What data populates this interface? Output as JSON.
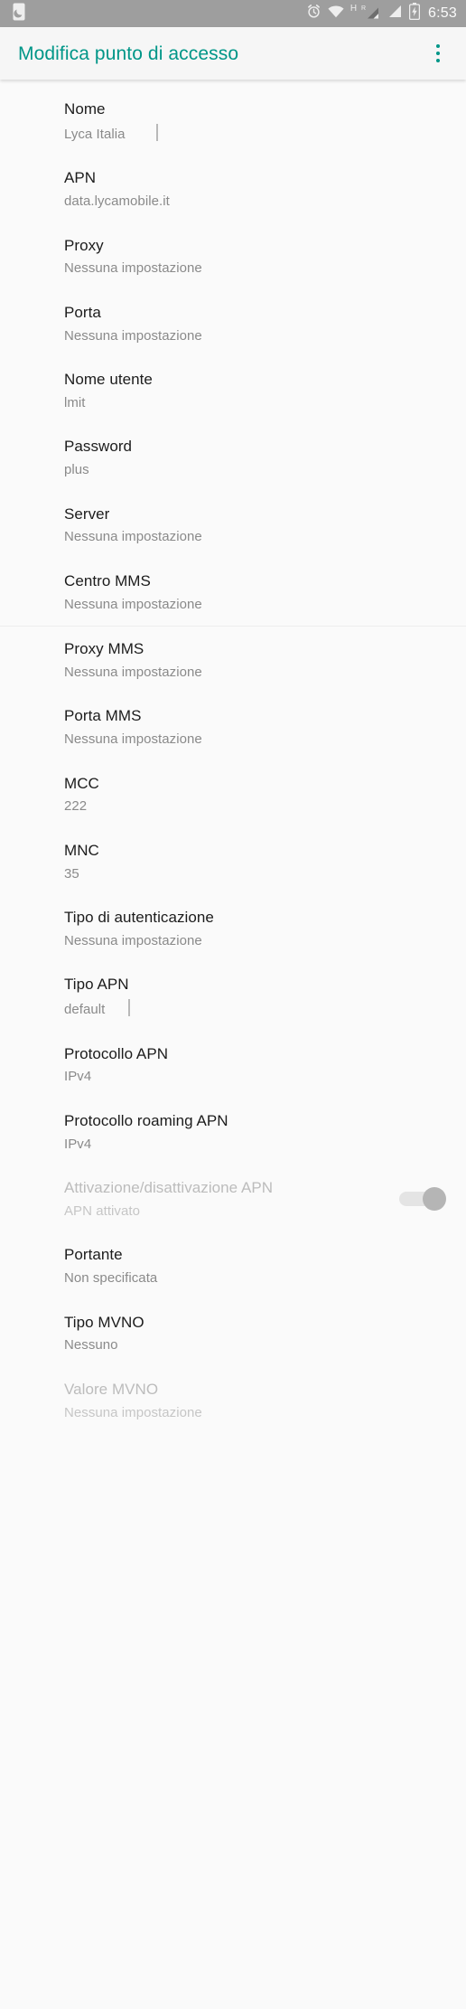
{
  "statusbar": {
    "left_icon": "dnd-moon-icon",
    "icons": [
      "alarm-icon",
      "wifi-icon"
    ],
    "network_label_h": "H",
    "network_label_r": "R",
    "battery_icon": "battery-charging-icon",
    "time": "6:53"
  },
  "toolbar": {
    "title": "Modifica punto di accesso",
    "overflow_label": "more-options"
  },
  "colors": {
    "accent": "#009688",
    "statusbar_bg": "#9e9e9e",
    "page_bg": "#fafafa",
    "title_text": "#1c1c1c",
    "sub_text": "#8a8a8a",
    "disabled_text": "#bcbcbc",
    "switch_thumb": "#b5b5b5",
    "switch_track": "#e4e4e4"
  },
  "rows": [
    {
      "title": "Nome",
      "value": "Lyca Italia",
      "caret": true,
      "disabled": false
    },
    {
      "title": "APN",
      "value": "data.lycamobile.it",
      "caret": false,
      "disabled": false
    },
    {
      "title": "Proxy",
      "value": "Nessuna impostazione",
      "caret": false,
      "disabled": false
    },
    {
      "title": "Porta",
      "value": "Nessuna impostazione",
      "caret": false,
      "disabled": false
    },
    {
      "title": "Nome utente",
      "value": "lmit",
      "caret": false,
      "disabled": false
    },
    {
      "title": "Password",
      "value": "plus",
      "caret": false,
      "disabled": false
    },
    {
      "title": "Server",
      "value": "Nessuna impostazione",
      "caret": false,
      "disabled": false
    },
    {
      "title": "Centro MMS",
      "value": "Nessuna impostazione",
      "caret": false,
      "disabled": false
    },
    {
      "title": "Proxy MMS",
      "value": "Nessuna impostazione",
      "caret": false,
      "disabled": false
    },
    {
      "title": "Porta MMS",
      "value": "Nessuna impostazione",
      "caret": false,
      "disabled": false
    },
    {
      "title": "MCC",
      "value": "222",
      "caret": false,
      "disabled": false
    },
    {
      "title": "MNC",
      "value": "35",
      "caret": false,
      "disabled": false
    },
    {
      "title": "Tipo di autenticazione",
      "value": "Nessuna impostazione",
      "caret": false,
      "disabled": false
    },
    {
      "title": "Tipo APN",
      "value": "default",
      "caret": true,
      "disabled": false
    },
    {
      "title": "Protocollo APN",
      "value": "IPv4",
      "caret": false,
      "disabled": false
    },
    {
      "title": "Protocollo roaming APN",
      "value": "IPv4",
      "caret": false,
      "disabled": false
    }
  ],
  "apn_toggle_row": {
    "title": "Attivazione/disattivazione APN",
    "value": "APN attivato",
    "switch_state": "on",
    "disabled": true
  },
  "rows_tail": [
    {
      "title": "Portante",
      "value": "Non specificata",
      "disabled": false
    },
    {
      "title": "Tipo MVNO",
      "value": "Nessuno",
      "disabled": false
    },
    {
      "title": "Valore MVNO",
      "value": "Nessuna impostazione",
      "disabled": true
    }
  ]
}
